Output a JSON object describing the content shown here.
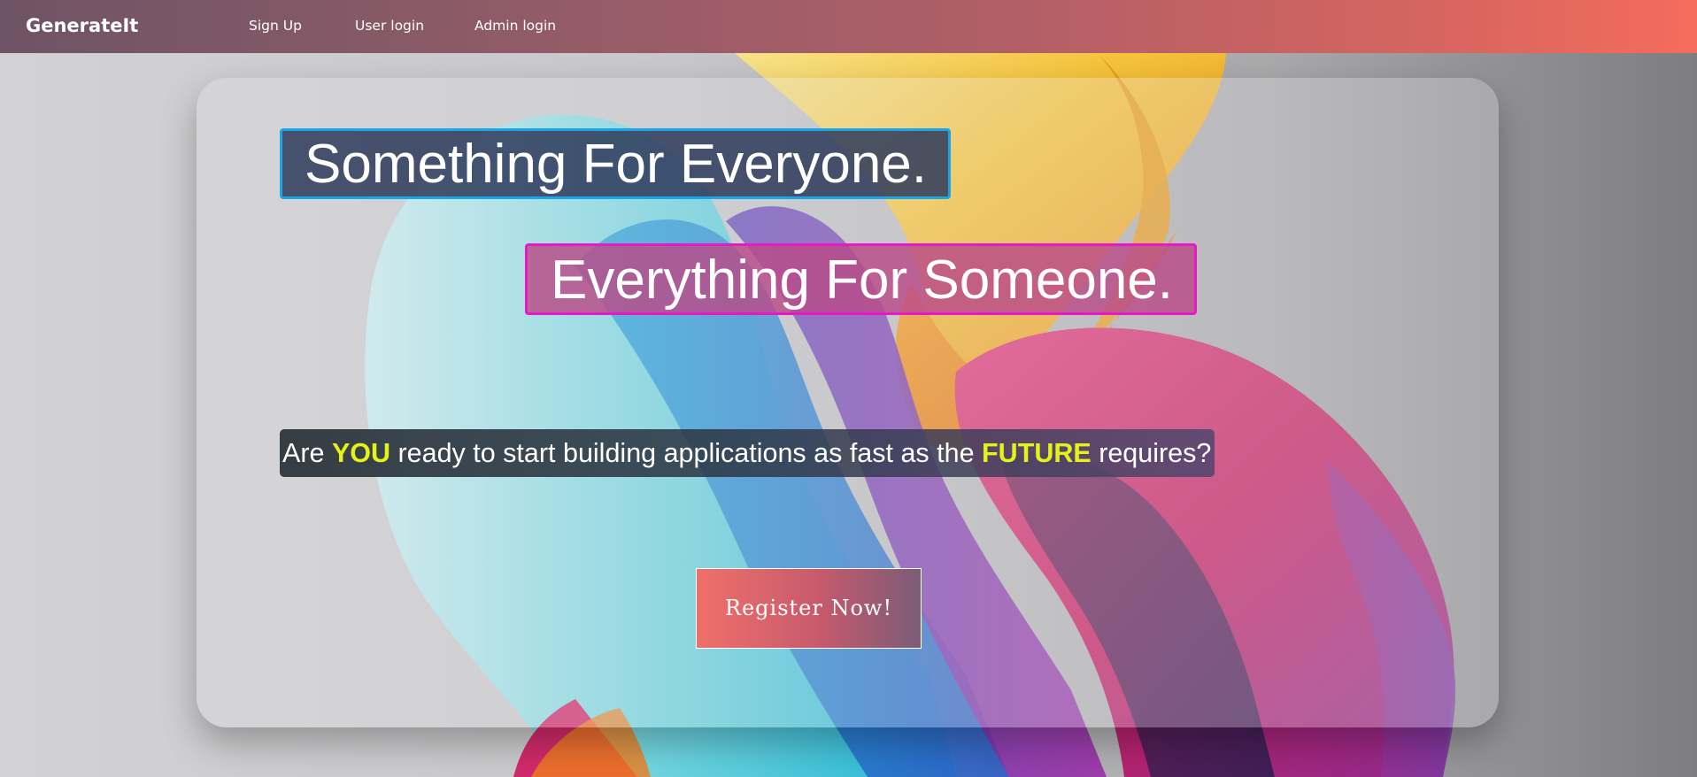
{
  "navbar": {
    "brand": "GenerateIt",
    "links": {
      "sign_up": "Sign Up",
      "user_login": "User login",
      "admin_login": "Admin login"
    }
  },
  "hero": {
    "headline_1": "Something For Everyone.",
    "headline_2": "Everything For Someone.",
    "tagline": {
      "part_1": "Are ",
      "highlight_1": "YOU",
      "part_2": " ready to start building applications as fast as the ",
      "highlight_2": "FUTURE",
      "part_3": " requires?"
    },
    "cta_label": "Register Now!"
  },
  "colors": {
    "nav_gradient_start": "#6e5466",
    "nav_gradient_end": "#f56c5c",
    "highlight_yellow": "#e4f21a",
    "headline_1_border": "#1aa5e6",
    "headline_2_border": "#e619c8"
  }
}
